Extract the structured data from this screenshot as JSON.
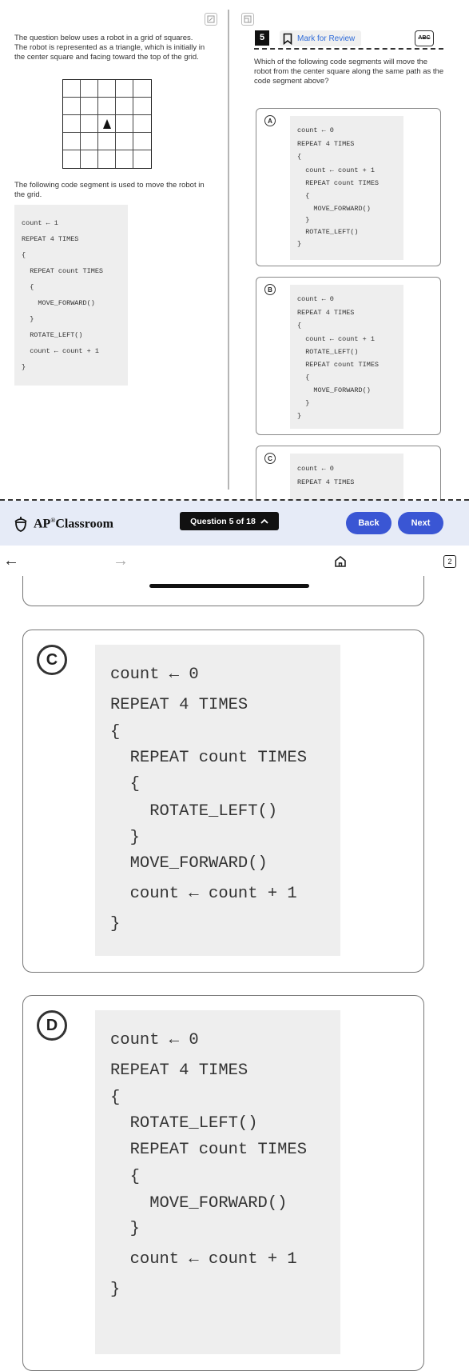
{
  "stimulus": {
    "intro": "The question below uses a robot in a grid of squares. The robot is represented as a triangle, which is initially in the center square and facing toward the top of the grid.",
    "code_intro": "The following code segment is used to move the robot in the grid.",
    "code": [
      "count ← 1",
      "REPEAT 4 TIMES",
      "{",
      "  REPEAT count TIMES",
      "  {",
      "    MOVE_FORWARD()",
      "  }",
      "  ROTATE_LEFT()",
      "  count ← count + 1",
      "}"
    ]
  },
  "question": {
    "number": "5",
    "mark_label": "Mark for Review",
    "abc_label": "ABC",
    "text": "Which of the following code segments will move the robot from the center square along the same path as the code segment above?"
  },
  "options_small": [
    {
      "letter": "A",
      "code": [
        "count ← 0",
        "REPEAT 4 TIMES",
        "{",
        "  count ← count + 1",
        "  REPEAT count TIMES",
        "  {",
        "    MOVE_FORWARD()",
        "  }",
        "  ROTATE_LEFT()",
        "}"
      ]
    },
    {
      "letter": "B",
      "code": [
        "count ← 0",
        "REPEAT 4 TIMES",
        "{",
        "  count ← count + 1",
        "  ROTATE_LEFT()",
        "  REPEAT count TIMES",
        "  {",
        "    MOVE_FORWARD()",
        "  }",
        "}"
      ]
    },
    {
      "letter": "C",
      "code": [
        "count ← 0",
        "REPEAT 4 TIMES"
      ]
    }
  ],
  "footer": {
    "brand": "AP",
    "brand_reg": "®",
    "brand_rest": "Classroom",
    "question_counter": "Question 5 of 18",
    "back_label": "Back",
    "next_label": "Next"
  },
  "browser_nav": {
    "back": "←",
    "forward": "→",
    "tab_count": "2"
  },
  "options_big": [
    {
      "letter": "C",
      "code": [
        "count ← 0",
        "REPEAT 4 TIMES",
        "{",
        "  REPEAT count TIMES",
        "  {",
        "    ROTATE_LEFT()",
        "  }",
        "  MOVE_FORWARD()",
        "  count ← count + 1",
        "}"
      ]
    },
    {
      "letter": "D",
      "code": [
        "count ← 0",
        "REPEAT 4 TIMES",
        "{",
        "  ROTATE_LEFT()",
        "  REPEAT count TIMES",
        "  {",
        "    MOVE_FORWARD()",
        "  }",
        "  count ← count + 1",
        "}"
      ]
    }
  ],
  "colors": {
    "accent": "#3a56d4",
    "footer_bg": "#e6ebf7",
    "code_bg": "#eeeeee",
    "link": "#2f6bd8"
  }
}
